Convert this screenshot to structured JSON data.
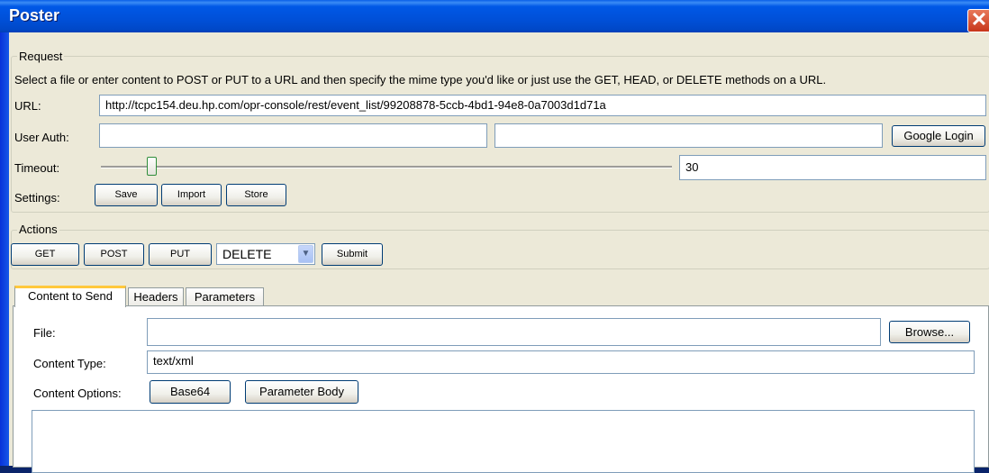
{
  "window": {
    "title": "Poster",
    "close_glyph": "✕"
  },
  "request": {
    "group_label": "Request",
    "description": "Select a file or enter content to POST or PUT to a URL and then specify the mime type you'd like or just use the GET, HEAD, or DELETE methods on a URL.",
    "url_label": "URL:",
    "url_value": "http://tcpc154.deu.hp.com/opr-console/rest/event_list/99208878-5ccb-4bd1-94e8-0a7003d1d71a",
    "user_auth_label": "User Auth:",
    "user_auth_user": "",
    "user_auth_pass": "",
    "google_login_label": "Google Login",
    "timeout_label": "Timeout:",
    "timeout_value": "30",
    "settings_label": "Settings:",
    "save_label": "Save",
    "import_label": "Import",
    "store_label": "Store"
  },
  "actions": {
    "group_label": "Actions",
    "get_label": "GET",
    "post_label": "POST",
    "put_label": "PUT",
    "method_selected": "DELETE",
    "submit_label": "Submit"
  },
  "tabs": [
    {
      "label": "Content to Send",
      "active": true
    },
    {
      "label": "Headers",
      "active": false
    },
    {
      "label": "Parameters",
      "active": false
    }
  ],
  "content": {
    "file_label": "File:",
    "file_value": "",
    "browse_label": "Browse...",
    "content_type_label": "Content Type:",
    "content_type_value": "text/xml",
    "content_options_label": "Content Options:",
    "base64_label": "Base64",
    "parameter_body_label": "Parameter Body",
    "body": ""
  }
}
